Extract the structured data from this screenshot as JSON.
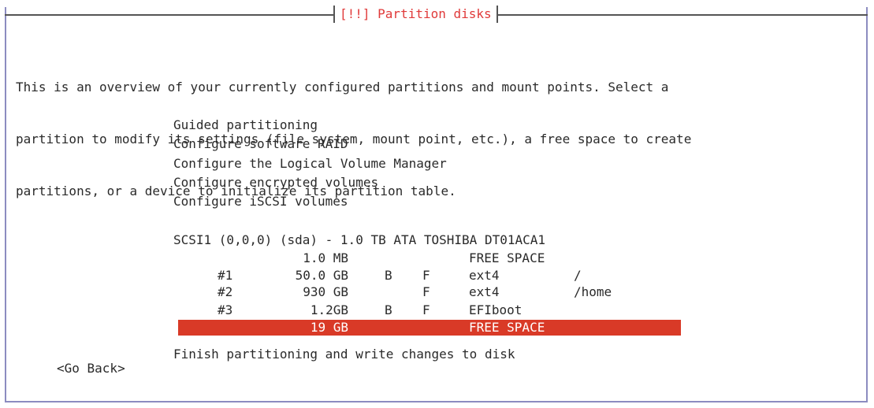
{
  "dialog": {
    "title": "[!!] Partition disks",
    "description": [
      "This is an overview of your currently configured partitions and mount points. Select a",
      "partition to modify its settings (file system, mount point, etc.), a free space to create",
      "partitions, or a device to initialize its partition table."
    ]
  },
  "menu": [
    "Guided partitioning",
    "Configure software RAID",
    "Configure the Logical Volume Manager",
    "Configure encrypted volumes",
    "Configure iSCSI volumes"
  ],
  "disk": {
    "header": "SCSI1 (0,0,0) (sda) - 1.0 TB ATA TOSHIBA DT01ACA1",
    "rows": [
      {
        "num": "",
        "size": "1.0 MB",
        "bootable": "",
        "format": "",
        "fs": "FREE SPACE",
        "mount": ""
      },
      {
        "num": "#1",
        "size": "50.0 GB",
        "bootable": "B",
        "format": "F",
        "fs": "ext4",
        "mount": "/"
      },
      {
        "num": "#2",
        "size": "930 GB",
        "bootable": "",
        "format": "F",
        "fs": "ext4",
        "mount": "/home"
      },
      {
        "num": "#3",
        "size": "1.2GB",
        "bootable": "B",
        "format": "F",
        "fs": "EFIboot",
        "mount": ""
      },
      {
        "num": "",
        "size": "19 GB",
        "bootable": "",
        "format": "",
        "fs": "FREE SPACE",
        "mount": ""
      }
    ],
    "selected_row_index": 4
  },
  "finish": "Finish partitioning and write changes to disk",
  "go_back": "<Go Back>",
  "colors": {
    "title": "#e03a3a",
    "selection": "#d93a27",
    "frame": "#8c8cc0"
  }
}
